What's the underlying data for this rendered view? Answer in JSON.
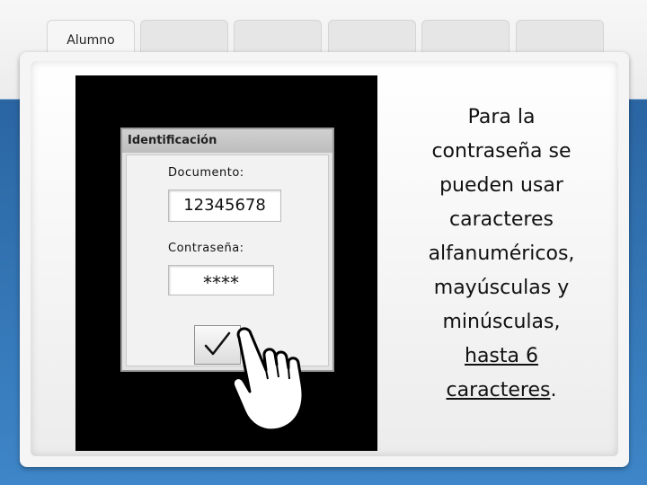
{
  "tabs": [
    {
      "label": "Alumno"
    },
    {
      "label": ""
    },
    {
      "label": ""
    },
    {
      "label": ""
    },
    {
      "label": ""
    },
    {
      "label": ""
    }
  ],
  "dialog": {
    "title": "Identificación",
    "documento_label": "Documento:",
    "documento_value": "12345678",
    "password_label": "Contraseña:",
    "password_value": "****",
    "ok_icon": "checkmark-icon"
  },
  "cursor_icon": "pointing-hand-icon",
  "caption": {
    "line1": "Para la",
    "line2": "contraseña se",
    "line3": "pueden usar",
    "line4": "caracteres",
    "line5": "alfanuméricos,",
    "line6": "mayúsculas y",
    "line7": "minúsculas,",
    "line8": "hasta 6",
    "line9": "caracteres",
    "line9_end": "."
  }
}
